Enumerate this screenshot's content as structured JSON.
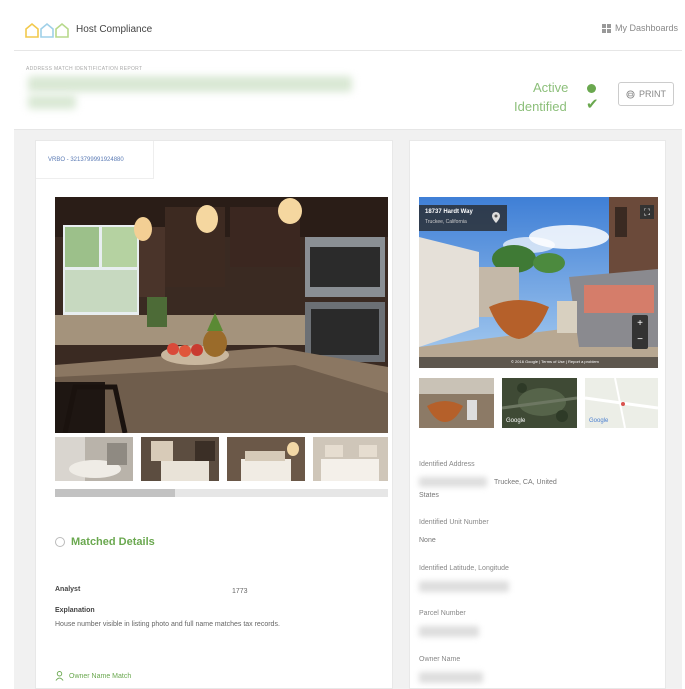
{
  "app": {
    "title": "Host Compliance",
    "dashboard_label": "My Dashboards"
  },
  "header": {
    "breadcrumb": "ADDRESS MATCH IDENTIFICATION REPORT",
    "status_active": "Active",
    "status_identified": "Identified",
    "print_label": "PRINT"
  },
  "listing": {
    "tab_label": "VRBO - 3213799991924880"
  },
  "matched": {
    "title": "Matched Details",
    "analyst_label": "Analyst",
    "analyst_value": "1773",
    "explanation_label": "Explanation",
    "explanation_text": "House number visible in listing photo and full name matches tax records.",
    "owner_match_label": "Owner Name Match"
  },
  "map": {
    "address_title": "18737 Hardt Way",
    "address_subtitle": "Truckee, California",
    "google_label": "Google",
    "google_label_2": "Google",
    "map_footer": "© 2016 Google | Terms of Use | Report a problem"
  },
  "identified": {
    "address_label": "Identified Address",
    "address_value": "Truckee, CA, United",
    "address_value_2": "States",
    "unit_label": "Identified Unit Number",
    "unit_value": "None",
    "latlng_label": "Identified Latitude, Longitude",
    "parcel_label": "Parcel Number",
    "owner_label": "Owner Name"
  }
}
